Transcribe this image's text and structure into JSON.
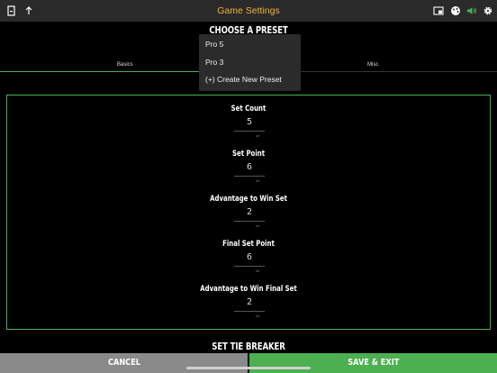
{
  "header": {
    "title": "Game Settings",
    "left_icons": [
      "exit-icon",
      "upload-icon"
    ],
    "right_icons": [
      "picture-in-picture-icon",
      "palette-icon",
      "volume-icon",
      "gear-icon"
    ],
    "accent_color": "#f0b23a"
  },
  "preset": {
    "heading": "CHOOSE A PRESET",
    "options": [
      "Pro 5",
      "Pro 3",
      "(+) Create New Preset"
    ]
  },
  "tabs": [
    {
      "label": "Basics",
      "selected": true
    },
    {
      "label": "Misc",
      "selected": false
    }
  ],
  "fields": [
    {
      "label": "Set Count",
      "value": "5",
      "unit": "/ct"
    },
    {
      "label": "Set Point",
      "value": "6",
      "unit": "/ct"
    },
    {
      "label": "Advantage to Win Set",
      "value": "2",
      "unit": "/ct"
    },
    {
      "label": "Final Set Point",
      "value": "6",
      "unit": "/ct"
    },
    {
      "label": "Advantage to Win Final Set",
      "value": "2",
      "unit": "/ct"
    }
  ],
  "tiebreaker": {
    "heading": "SET TIE BREAKER"
  },
  "buttons": {
    "cancel": "CANCEL",
    "save": "SAVE & EXIT"
  },
  "colors": {
    "green": "#4caf50",
    "cancel_gray": "#8a8a8a",
    "topbar": "#2a2a2a"
  }
}
